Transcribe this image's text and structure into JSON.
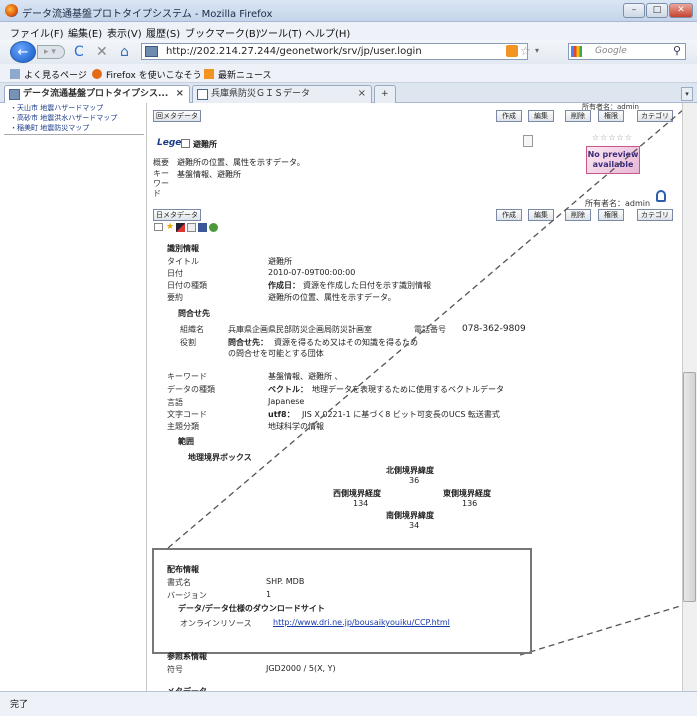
{
  "window": {
    "title": "データ流通基盤プロトタイプシステム - Mozilla Firefox",
    "buttons": {
      "minimize": "–",
      "maximize": "□",
      "close": "✕"
    }
  },
  "menu": [
    "ファイル(F)",
    "編集(E)",
    "表示(V)",
    "履歴(S)",
    "ブックマーク(B)",
    "ツール(T)",
    "ヘルプ(H)"
  ],
  "nav": {
    "url": "http://202.214.27.244/geonetwork/srv/jp/user.login",
    "search_placeholder": "Google",
    "back_label": "←"
  },
  "bookmarks": [
    "よく見るページ",
    "Firefox を使いこなそう",
    "最新ニュース"
  ],
  "tabs": [
    {
      "label": "データ流通基盤プロトタイプシス...",
      "close": "×"
    },
    {
      "label": "兵庫県防災ＧＩＳデータ",
      "close": "×"
    }
  ],
  "tab_new": "+",
  "sidebar": {
    "links": [
      "・天山市 地震ハザードマップ",
      "・高砂市 地震洪水ハザードマップ",
      "・稲美町 地震防災マップ"
    ]
  },
  "record1": {
    "metadata_btn": "回メタデータ",
    "owner": "所有者名：admin",
    "actions": [
      "作成",
      "編集",
      "削除",
      "権限",
      "カテゴリ"
    ],
    "logo": "Lege",
    "title": "避難所",
    "label_summary": "概要",
    "summary": "避難所の位置、属性を示すデータ。",
    "label_keywords": "キーワード",
    "keywords": "基盤情報、避難所",
    "preview": "No preview available",
    "stars": "☆☆☆☆☆"
  },
  "record2": {
    "metadata_btn": "日メタデータ",
    "owner": "所有者名：admin",
    "actions": [
      "作成",
      "編集",
      "削除",
      "権限",
      "カテゴリ"
    ],
    "ident_heading": "識別情報",
    "fields": [
      {
        "label": "タイトル",
        "value": "避難所"
      },
      {
        "label": "日付",
        "value": "2010-07-09T00:00:00"
      },
      {
        "label": "日付の種類",
        "value_bold": "作成日：",
        "value": "資源を作成した日付を示す識別情報"
      },
      {
        "label": "要約",
        "value": "避難所の位置、属性を示すデータ。"
      }
    ],
    "contact_heading": "問合せ先",
    "org_label": "組織名",
    "org_value": "兵庫県企画県民部防災企画局防災計画室",
    "phone_label": "電話番号",
    "phone_value": "078-362-9809",
    "role_label": "役割",
    "role_bold": "問合せ先：",
    "role_value_1": "資源を得るため又はその知識を得るため",
    "role_value_2": "の問合せを可能とする団体",
    "fields2": [
      {
        "label": "キーワード",
        "value": "基盤情報、避難所 、"
      },
      {
        "label": "データの種類",
        "value_bold": "ベクトル：",
        "value": "地理データを表現するために使用するベクトルデータ"
      },
      {
        "label": "言語",
        "value": "Japanese"
      },
      {
        "label": "文字コード",
        "value_bold": "utf8：",
        "value": "JIS X 0221-1 に基づく8 ビット可変長のUCS 転送書式"
      },
      {
        "label": "主題分類",
        "value": "地球科学の情報"
      }
    ],
    "extent_heading": "範囲",
    "bbox_heading": "地理境界ボックス",
    "north_label": "北側境界緯度",
    "north": "36",
    "west_label": "西側境界経度",
    "west": "134",
    "east_label": "東側境界経度",
    "east": "136",
    "south_label": "南側境界緯度",
    "south": "34"
  },
  "distribution": {
    "heading": "配布情報",
    "format_label": "書式名",
    "format": "SHP. MDB",
    "version_label": "バージョン",
    "version": "1",
    "download_heading": "データ/データ仕様のダウンロードサイト",
    "online_label": "オンラインリソース",
    "online_url": "http://www.dri.ne.jp/bousaikyouiku/CCP.html"
  },
  "ref_system": {
    "heading": "参照系情報",
    "code_label": "符号",
    "code": "JGD2000 / 5(X, Y)"
  },
  "meta_heading": "メタデータ",
  "status": "完了",
  "colors": {
    "link": "#1a3aa8",
    "titlebar": "#c4d4ea",
    "callout": "#777777"
  }
}
